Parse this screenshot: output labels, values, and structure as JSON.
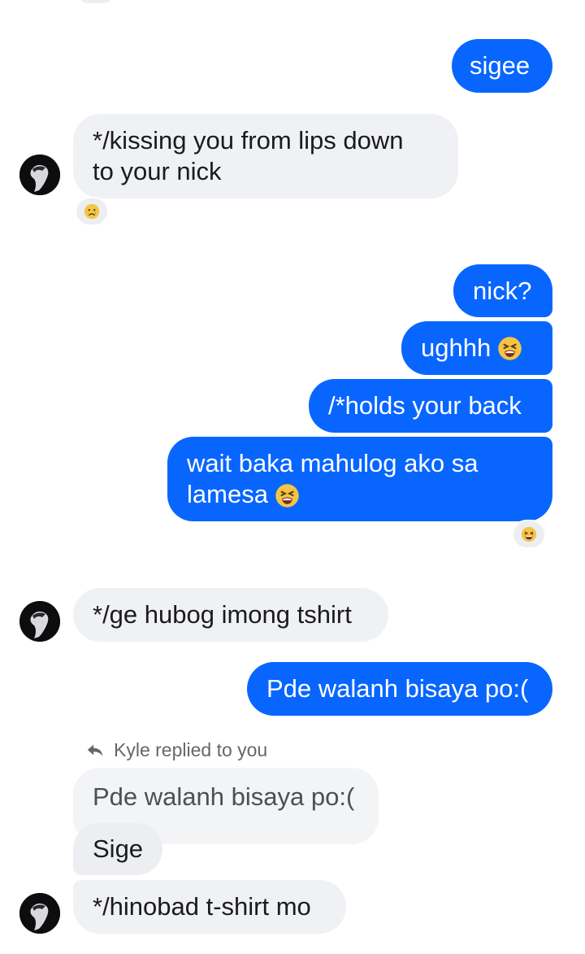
{
  "messages": [
    {
      "id": "m1",
      "side": "out",
      "text": "sigee"
    },
    {
      "id": "m2",
      "side": "in",
      "text": "*/kissing you from lips down\nto your nick",
      "reaction": "crying-face-emoji"
    },
    {
      "id": "m3",
      "side": "out",
      "text": "nick?"
    },
    {
      "id": "m4",
      "side": "out",
      "text": "ughhh",
      "emoji": "tired-face-emoji"
    },
    {
      "id": "m5",
      "side": "out",
      "text": "/*holds your back"
    },
    {
      "id": "m6",
      "side": "out",
      "text": "wait baka mahulog ako sa\nlamesa",
      "emoji": "tired-face-emoji",
      "reaction": "laughing-face-emoji"
    },
    {
      "id": "m7",
      "side": "in",
      "text": "*/ge hubog imong tshirt"
    },
    {
      "id": "m8",
      "side": "out",
      "text": "Pde walanh bisaya po:("
    },
    {
      "id": "m9",
      "side": "in",
      "text": "Sige",
      "reply_label": "Kyle replied to you",
      "quoted_text": "Pde walanh bisaya po:("
    },
    {
      "id": "m10",
      "side": "in",
      "text": "*/hinobad t-shirt mo"
    }
  ],
  "colors": {
    "outgoing_bubble": "#0866ff",
    "incoming_bubble": "#eff1f4",
    "quoted_bubble": "#f3f4f6",
    "secondary_text": "#65676b",
    "background": "#ffffff"
  },
  "icons": {
    "reply": "reply-arrow-icon",
    "avatar": "user-avatar"
  }
}
